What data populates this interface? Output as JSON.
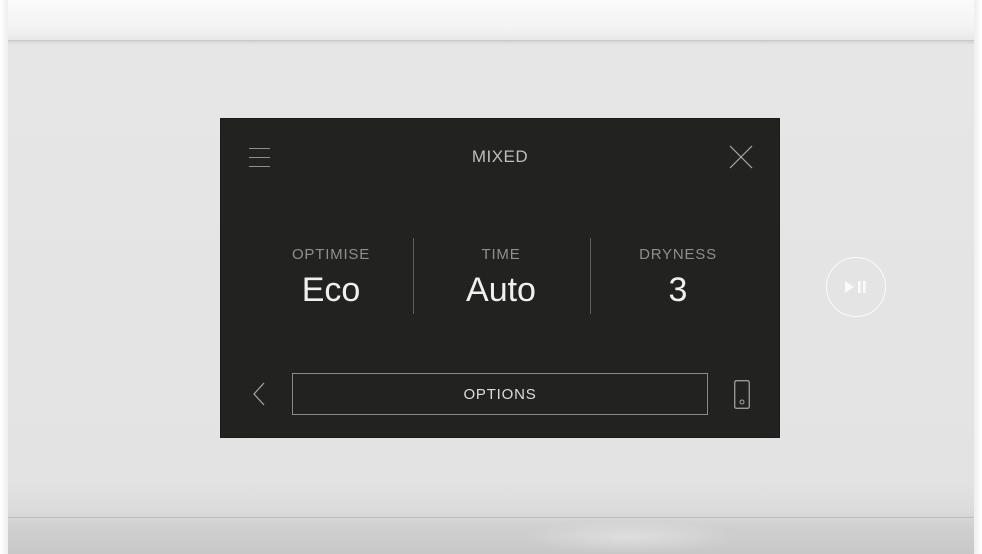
{
  "screen": {
    "title": "MIXED"
  },
  "settings": {
    "optimise": {
      "label": "OPTIMISE",
      "value": "Eco"
    },
    "time": {
      "label": "TIME",
      "value": "Auto"
    },
    "dryness": {
      "label": "DRYNESS",
      "value": "3"
    }
  },
  "footer": {
    "options_label": "OPTIONS"
  },
  "icons": {
    "menu": "menu-icon",
    "close": "close-icon",
    "back": "chevron-left-icon",
    "phone": "phone-icon",
    "play_pause": "play-pause-icon"
  },
  "colors": {
    "screen_background": "#222220",
    "panel_background": "#e3e3e3",
    "primary_text": "#f0f0ee",
    "secondary_text": "#8f8f8d"
  }
}
